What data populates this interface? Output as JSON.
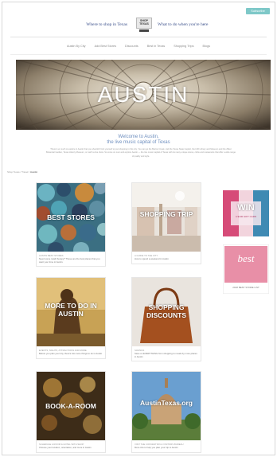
{
  "header": {
    "subscribe_label": "Subscribe",
    "tagline_left": "Where to shop in Texas",
    "tagline_right": "What to do when you're here",
    "logo_text": "SHOP TEXAS"
  },
  "nav": {
    "items": [
      "Austin By City",
      "Add Best Stores",
      "Discounts",
      "Best in Texas",
      "Shopping Trips",
      "Blogs"
    ]
  },
  "hero": {
    "title": "AUSTIN"
  },
  "welcome": {
    "line1": "Welcome to Austin,",
    "line2": "the live music capital of Texas"
  },
  "intro_text": "There's so much to explore in Austin that you shouldn't limit yourself to just shopping in this city. You can go the Barton Creek, visit the Texas State Capitol, the LBJ Library and Museum and the Zilker Botanical Garden, Texas History Museum, or catch a live show. So come on over and explore Austin — the live music capital of Texas with its many unique stores, clubs and restaurants that offer a wide range of quality and style.",
  "breadcrumb": {
    "prefix": "Shop Texas / Travel /",
    "current": "Austin"
  },
  "cards": [
    {
      "overlay": "BEST STORES",
      "category": "AUSTIN BEST STORES",
      "desc": "Need some retail therapy? These are the best places that you want your time in Austin."
    },
    {
      "overlay": "SHOPPING TRIP",
      "category": "A GUIDE TO THE CITY",
      "desc": "How to spend a weekend in Austin"
    },
    {
      "overlay": "MORE TO DO IN AUSTIN",
      "category": "EVENTS, SIGHTS, ATTRACTIONS AND MORE",
      "desc": "Before you plan your trip, there's lots more things to do in Austin"
    },
    {
      "overlay": "SHOPPING DISCOUNTS",
      "category": "SAVINGS",
      "desc": "Save on EVERYTHING from shopping to meals by more places in Austin"
    },
    {
      "overlay": "BOOK-A-ROOM",
      "category": "SCHEDULE A ROOM & HOTEL WITH SHOP",
      "desc": "Choose your location, orientation, and more in Austin"
    },
    {
      "overlay": "AustinTexas.org",
      "category": "VISIT THE CONVENTION & VISITORS BUREAU",
      "desc": "More info to help you plan your trip to Austin"
    }
  ],
  "sidebar_ads": [
    {
      "title": "WIN",
      "subtitle": "A $100 GIFT CARD"
    },
    {
      "title": "best",
      "subtitle": "2018 BEST STORE LIST"
    }
  ],
  "colors": {
    "accent": "#6f8fbf",
    "subscribe": "#7ec8c8",
    "brand": "#3a4f8a"
  }
}
